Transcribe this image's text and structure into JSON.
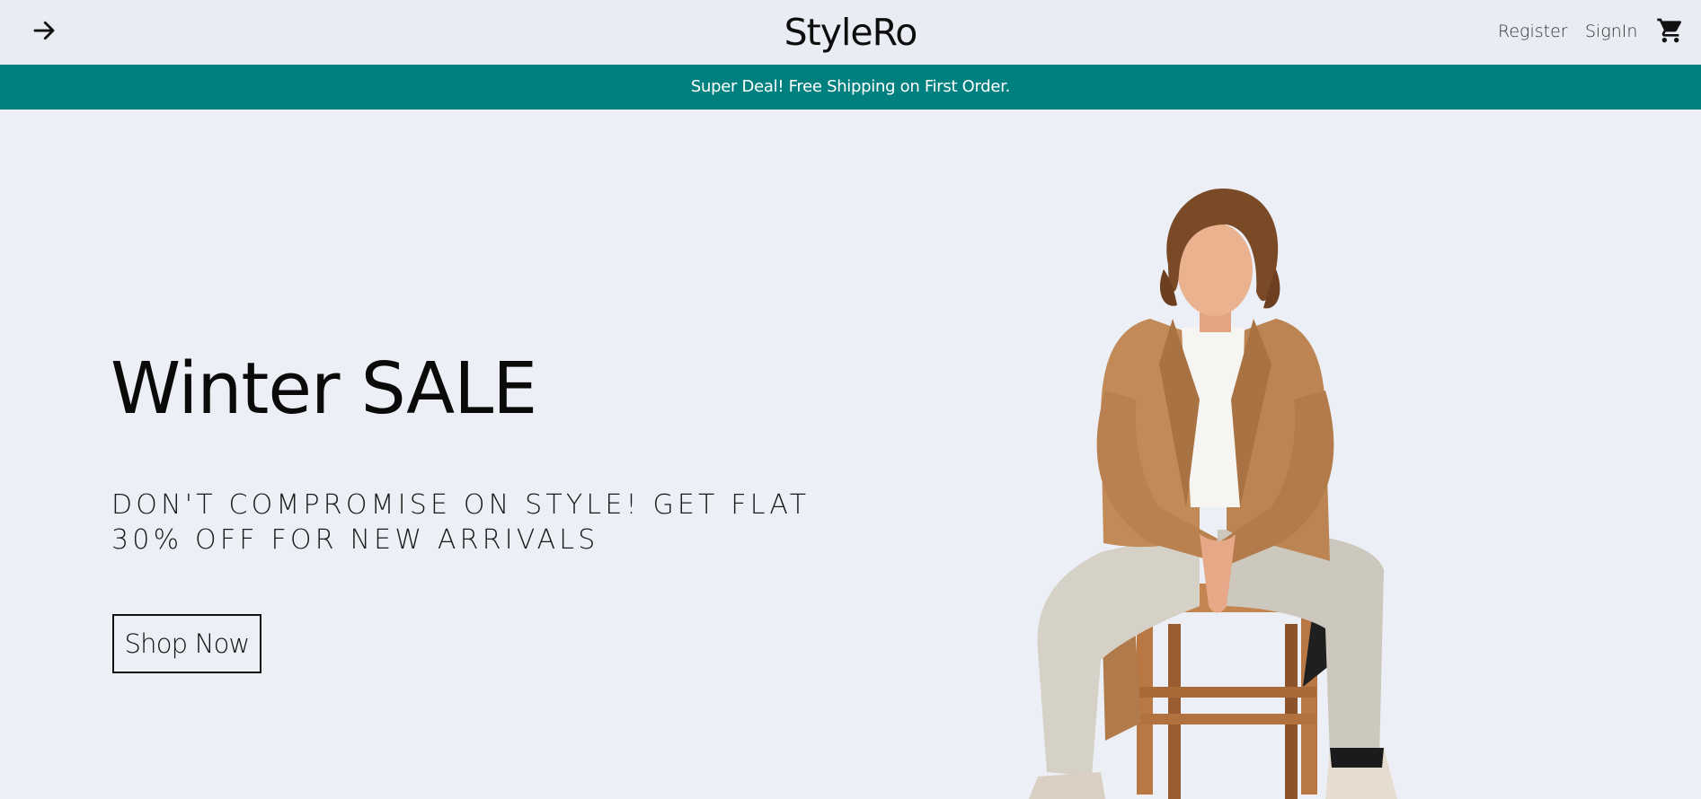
{
  "brand": {
    "logo": "StyleRo"
  },
  "nav": {
    "register": "Register",
    "signin": "SignIn"
  },
  "announcement": {
    "text": "Super Deal! Free Shipping on First Order."
  },
  "hero": {
    "title": "Winter SALE",
    "description": "DON'T COMPROMISE ON STYLE! GET FLAT 30% OFF FOR NEW ARRIVALS",
    "cta_label": "Shop Now"
  },
  "icons": {
    "nav_left": "arrow-right-icon",
    "cart": "cart-icon"
  },
  "colors": {
    "accent": "#00807f",
    "background": "#eceff5",
    "text": "#111111"
  }
}
